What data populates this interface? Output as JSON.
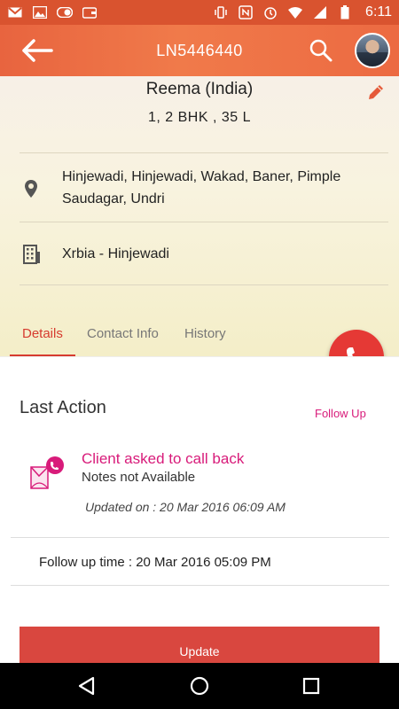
{
  "status_bar": {
    "time": "6:11",
    "left_icons": [
      "gmail-icon",
      "gallery-icon",
      "toggle-icon",
      "wallet-icon"
    ],
    "right_icons": [
      "vibrate-icon",
      "nfc-icon",
      "alarm-icon",
      "wifi-icon",
      "signal-icon",
      "battery-icon"
    ]
  },
  "app_bar": {
    "title": "LN5446440"
  },
  "lead": {
    "name": "Reema (India)",
    "requirement": "1, 2 BHK , 35 L",
    "locations": "Hinjewadi, Hinjewadi, Wakad, Baner, Pimple Saudagar, Undri",
    "project": "Xrbia - Hinjewadi"
  },
  "tabs": [
    {
      "label": "Details",
      "active": true
    },
    {
      "label": "Contact Info",
      "active": false
    },
    {
      "label": "History",
      "active": false
    }
  ],
  "last_action": {
    "section_title": "Last Action",
    "follow_up_label": "Follow Up",
    "title": "Client asked to call back",
    "notes": "Notes not Available",
    "updated": "Updated on : 20 Mar 2016 06:09 AM",
    "follow_up_time": "Follow up time : 20 Mar 2016 05:09 PM"
  },
  "update_button": "Update",
  "colors": {
    "accent": "#d63b2f",
    "app_bar": "#ec6a42",
    "pink": "#d81b7a",
    "fab": "#e53935"
  }
}
